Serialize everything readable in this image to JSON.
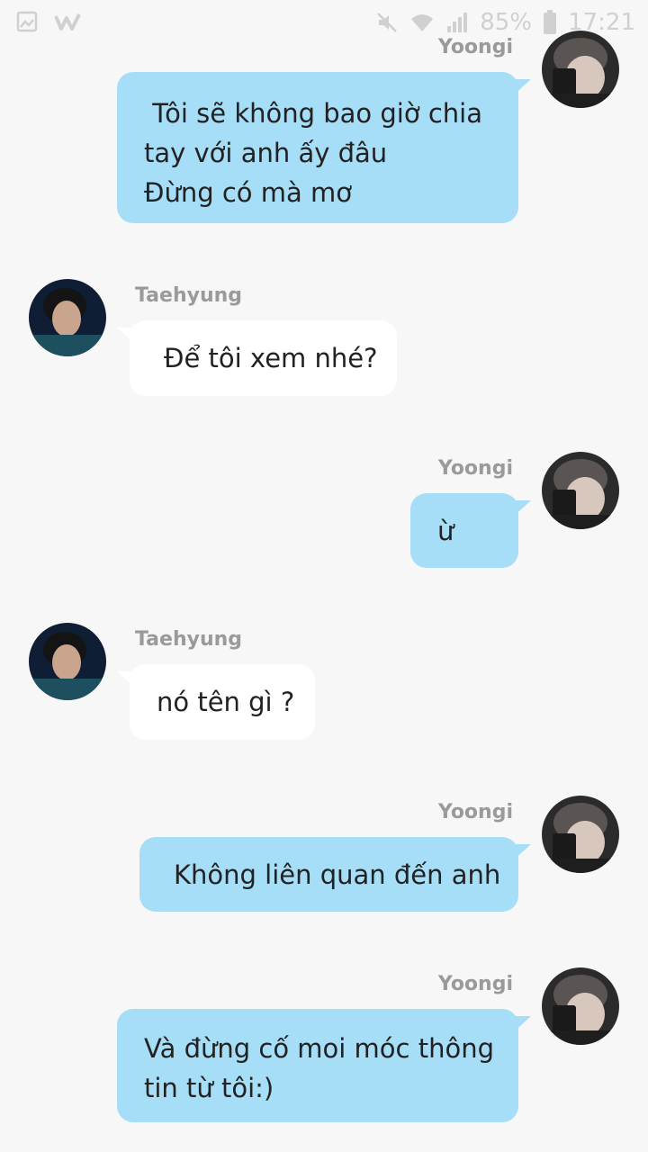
{
  "status_bar": {
    "battery": "85%",
    "time": "17:21",
    "icons": [
      "gallery-icon",
      "wattpad-icon",
      "mute-icon",
      "wifi-icon",
      "signal-icon",
      "battery-icon"
    ]
  },
  "colors": {
    "sent_bubble": "#a6ddf7",
    "received_bubble": "#ffffff",
    "background": "#f7f7f7"
  },
  "messages": [
    {
      "sender": "Yoongi",
      "direction": "sent",
      "lines": [
        " Tôi sẽ không bao giờ chia",
        "tay với anh ấy đâu",
        "Đừng có mà mơ"
      ]
    },
    {
      "sender": "Taehyung",
      "direction": "received",
      "lines": [
        "Để tôi xem nhé?"
      ]
    },
    {
      "sender": "Yoongi",
      "direction": "sent",
      "lines": [
        "ừ"
      ]
    },
    {
      "sender": "Taehyung",
      "direction": "received",
      "lines": [
        "nó tên gì ?"
      ]
    },
    {
      "sender": "Yoongi",
      "direction": "sent",
      "lines": [
        "Không liên quan đến anh"
      ]
    },
    {
      "sender": "Yoongi",
      "direction": "sent",
      "lines": [
        "Và đừng cố moi móc thông",
        "tin từ tôi:)"
      ]
    }
  ]
}
